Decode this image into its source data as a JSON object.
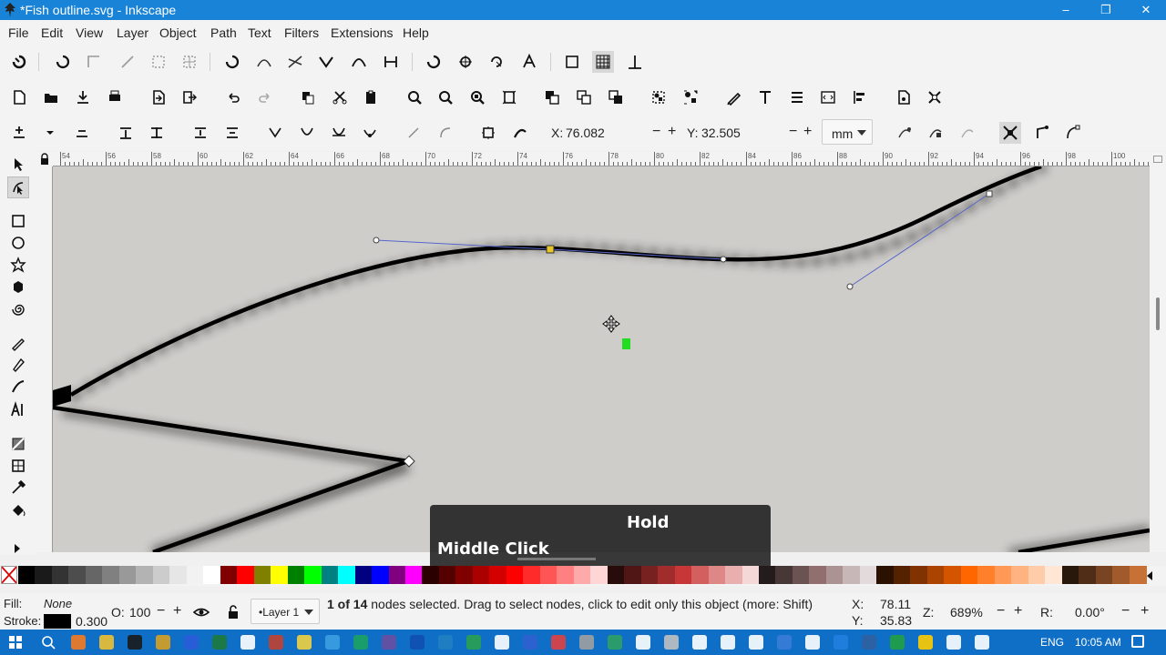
{
  "window": {
    "title": "*Fish outline.svg - Inkscape",
    "minimize": "–",
    "restore": "❐",
    "close": "✕"
  },
  "menu": [
    "File",
    "Edit",
    "View",
    "Layer",
    "Object",
    "Path",
    "Text",
    "Filters",
    "Extensions",
    "Help"
  ],
  "node_toolbar": {
    "x_label": "X:",
    "x_value": "76.082",
    "y_label": "Y:",
    "y_value": "32.505",
    "unit": "mm",
    "minus": "−",
    "plus": "+"
  },
  "ruler": {
    "labels": [
      "54",
      "56",
      "58",
      "60",
      "62",
      "64",
      "66",
      "68",
      "70",
      "72",
      "74",
      "76",
      "78",
      "80",
      "82",
      "84",
      "86",
      "88",
      "90",
      "92",
      "94",
      "96",
      "98",
      "100"
    ]
  },
  "overlay": {
    "hold": "Hold",
    "action": "Middle Click"
  },
  "status": {
    "fill_label": "Fill:",
    "fill_value": "None",
    "stroke_label": "Stroke:",
    "stroke_width": "0.300",
    "opacity_label": "O:",
    "opacity_value": "100",
    "layer": "•Layer 1",
    "message_bold": "1 of 14",
    "message_rest": " nodes selected. Drag to select nodes, click to edit only this object (more: Shift)",
    "cursor_x_label": "X:",
    "cursor_x": "78.11",
    "cursor_y_label": "Y:",
    "cursor_y": "35.83",
    "zoom_label": "Z:",
    "zoom_value": "689%",
    "rotation_label": "R:",
    "rotation_value": "0.00°"
  },
  "taskbar": {
    "lang": "ENG",
    "time": "10:05 AM"
  },
  "colors": {
    "titlebar": "#1883d7",
    "canvas": "#cfcdca",
    "selected_node": "#e8c628",
    "taskbar": "#0f6fc6"
  }
}
